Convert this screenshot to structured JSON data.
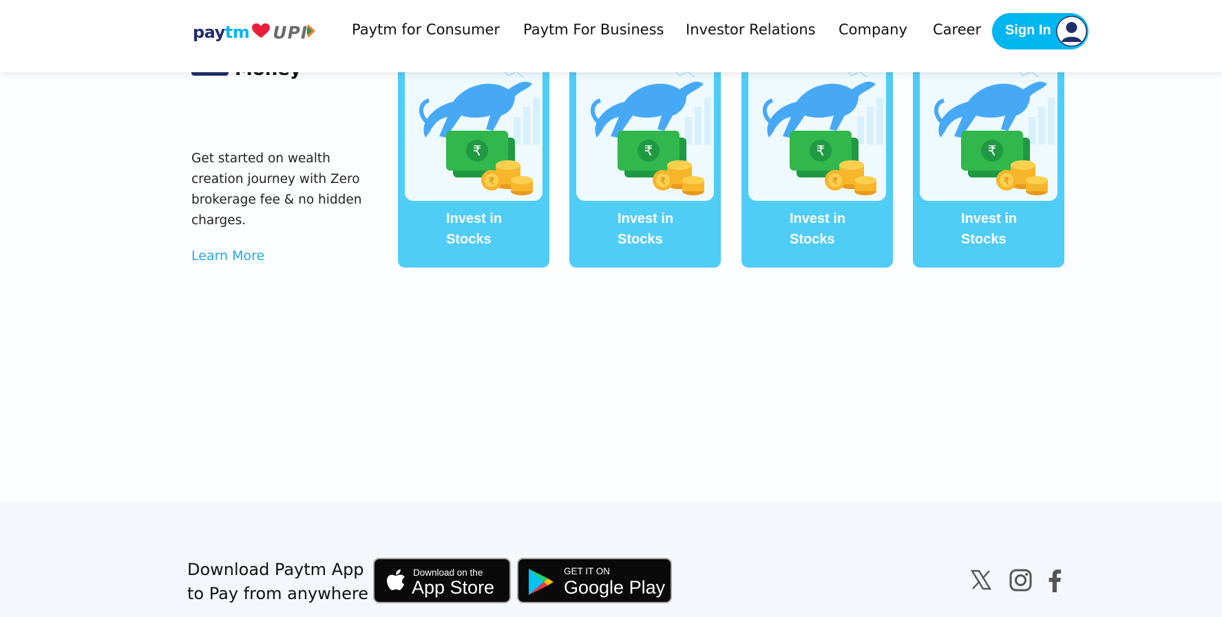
{
  "header": {
    "logo": {
      "pay": "pay",
      "tm": "tm",
      "upi": "UPI"
    },
    "nav": [
      {
        "label": "Paytm for Consumer"
      },
      {
        "label": "Paytm For Business"
      },
      {
        "label": "Investor Relations"
      },
      {
        "label": "Company"
      },
      {
        "label": "Career"
      }
    ],
    "signin_label": "Sign In"
  },
  "section": {
    "title": "Money",
    "description": "Get started on wealth creation journey with Zero brokerage fee & no hidden charges.",
    "learn_more": "Learn More",
    "cards": [
      {
        "label": "Invest in Stocks"
      },
      {
        "label": "Invest in Stocks"
      },
      {
        "label": "Invest in Stocks"
      },
      {
        "label": "Invest in Stocks"
      }
    ]
  },
  "footer": {
    "download_text": "Download Paytm App to Pay from anywhere",
    "app_store": {
      "small": "Download on the",
      "big": "App Store"
    },
    "google_play": {
      "small": "GET IT ON",
      "big": "Google Play"
    },
    "social": [
      "x-icon",
      "instagram-icon",
      "facebook-icon"
    ]
  },
  "colors": {
    "brand_blue": "#02b6f0",
    "navy": "#1f2f6b",
    "card_blue": "#4fcdf6",
    "link": "#25a9e0"
  }
}
